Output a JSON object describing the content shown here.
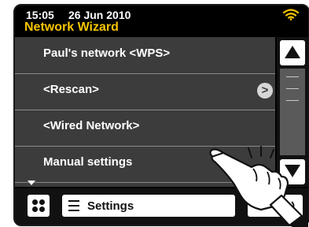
{
  "status": {
    "time": "15:05",
    "date": "26 Jun 2010",
    "wifi_icon": "wifi-icon",
    "accent_color": "#f5c400"
  },
  "screen": {
    "title": "Network Wizard"
  },
  "menu": {
    "items": [
      {
        "label": "Paul's network <WPS>"
      },
      {
        "label": "<Rescan>",
        "has_chevron": true
      },
      {
        "label": "<Wired Network>"
      },
      {
        "label": "Manual settings"
      }
    ],
    "chevron_glyph": ">"
  },
  "bottom": {
    "settings_label": "Settings",
    "grid_icon": "grid-icon",
    "menu_icon": "menu-icon",
    "volume_icon": "speaker-icon"
  }
}
